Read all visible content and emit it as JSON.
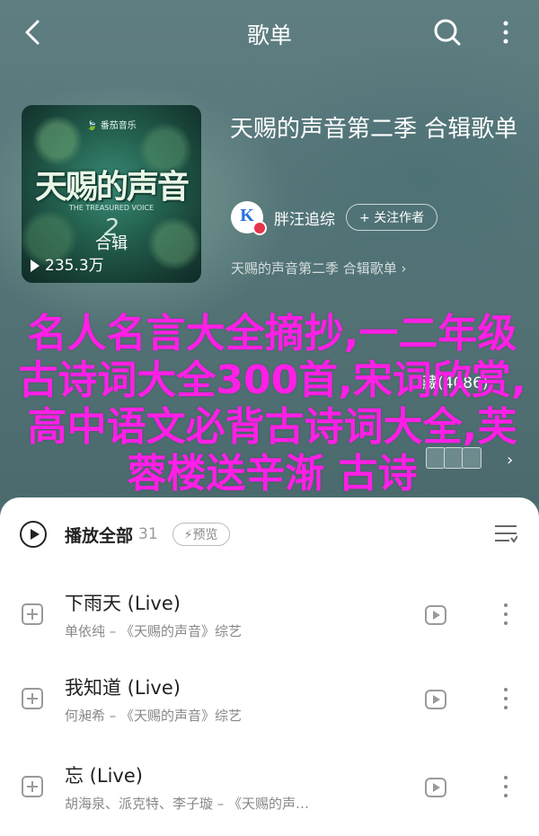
{
  "topbar": {
    "title": "歌单",
    "back_icon": "chevron-left-icon",
    "search_icon": "search-icon",
    "more_icon": "more-vertical-icon"
  },
  "cover": {
    "logo_text": "🍃 番茄音乐",
    "show_title": "天赐的声音",
    "show_subtitle": "THE TREASURED VOICE",
    "season": "2",
    "tag": "合辑",
    "plays": "235.3万"
  },
  "playlist": {
    "title": "天赐的声音第二季 合辑歌单",
    "creator_name": "胖汪追综",
    "follow_label": "+ 关注作者",
    "description": "天赐的声音第二季 合辑歌单 ›"
  },
  "overlay": {
    "text": "名人名言大全摘抄,一二年级古诗词大全300首,宋词欣赏,高中语文必背古诗词大全,芙蓉楼送辛渐 古诗"
  },
  "actions": {
    "favorite": "藏(4086)",
    "row2_left": "词大全,芙"
  },
  "list_header": {
    "play_all_label": "播放全部",
    "count": "31",
    "preview_label": "⚡预览"
  },
  "songs": [
    {
      "name": "下雨天 (Live)",
      "meta": "单依纯 – 《天赐的声音》综艺"
    },
    {
      "name": "我知道 (Live)",
      "meta": "何昶希 – 《天赐的声音》综艺"
    },
    {
      "name": "忘 (Live)",
      "meta": "胡海泉、派克特、李子璇 – 《天赐的声…"
    }
  ],
  "colors": {
    "header_bg": "#557578",
    "overlay_text": "#ff1fe6",
    "sheet_bg": "#ffffff"
  }
}
